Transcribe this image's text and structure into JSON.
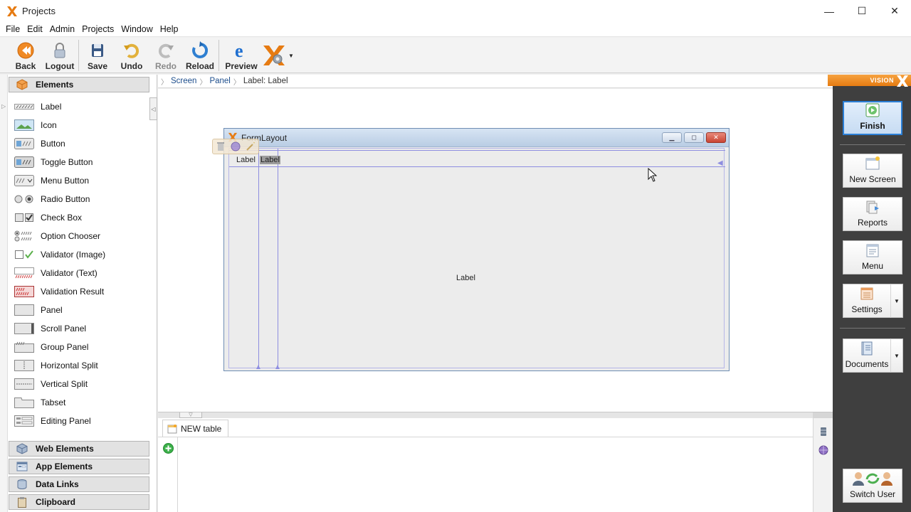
{
  "window": {
    "title": "Projects",
    "minimize": "—",
    "maximize": "☐",
    "close": "✕"
  },
  "menu": [
    "File",
    "Edit",
    "Admin",
    "Projects",
    "Window",
    "Help"
  ],
  "toolbar": {
    "back": "Back",
    "logout": "Logout",
    "save": "Save",
    "undo": "Undo",
    "redo": "Redo",
    "reload": "Reload",
    "preview": "Preview"
  },
  "left": {
    "elements_header": "Elements",
    "items": [
      {
        "label": "Label",
        "icon": "label-icon"
      },
      {
        "label": "Icon",
        "icon": "image-icon"
      },
      {
        "label": "Button",
        "icon": "button-icon"
      },
      {
        "label": "Toggle Button",
        "icon": "toggle-button-icon"
      },
      {
        "label": "Menu Button",
        "icon": "menu-button-icon"
      },
      {
        "label": "Radio Button",
        "icon": "radio-icon"
      },
      {
        "label": "Check Box",
        "icon": "checkbox-icon"
      },
      {
        "label": "Option Chooser",
        "icon": "option-icon"
      },
      {
        "label": "Validator (Image)",
        "icon": "validator-image-icon"
      },
      {
        "label": "Validator (Text)",
        "icon": "validator-text-icon"
      },
      {
        "label": "Validation Result",
        "icon": "validation-result-icon"
      },
      {
        "label": "Panel",
        "icon": "panel-icon"
      },
      {
        "label": "Scroll Panel",
        "icon": "scroll-panel-icon"
      },
      {
        "label": "Group Panel",
        "icon": "group-panel-icon"
      },
      {
        "label": "Horizontal Split",
        "icon": "hsplit-icon"
      },
      {
        "label": "Vertical Split",
        "icon": "vsplit-icon"
      },
      {
        "label": "Tabset",
        "icon": "tabset-icon"
      },
      {
        "label": "Editing Panel",
        "icon": "editing-panel-icon"
      }
    ],
    "web_elements": "Web Elements",
    "app_elements": "App Elements",
    "data_links": "Data Links",
    "clipboard": "Clipboard"
  },
  "breadcrumb": {
    "screen": "Screen",
    "panel": "Panel",
    "current": "Label: Label"
  },
  "form": {
    "title": "FormLayout",
    "label1": "Label",
    "label2": "Label",
    "center_label": "Label"
  },
  "bottom": {
    "tab": "NEW table"
  },
  "right": {
    "brand": "VISION",
    "finish": "Finish",
    "new_screen": "New Screen",
    "reports": "Reports",
    "menu": "Menu",
    "settings": "Settings",
    "documents": "Documents",
    "switch_user": "Switch User"
  },
  "colors": {
    "accent_orange": "#e67b12",
    "selection_blue": "#2b7fd6",
    "right_panel_bg": "#3f3f3f"
  }
}
